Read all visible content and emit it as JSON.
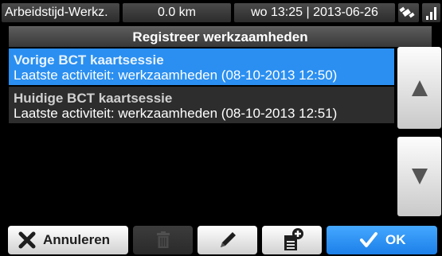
{
  "status": {
    "app_name": "Arbeidstijd-Werkz.",
    "distance": "0.0 km",
    "datetime": "wo 13:25 | 2013-06-26"
  },
  "dialog": {
    "title": "Registreer werkzaamheden"
  },
  "sessions": [
    {
      "name": "Vorige BCT kaartsessie",
      "activity": "Laatste activiteit: werkzaamheden (08-10-2013 12:50)",
      "selected": true
    },
    {
      "name": "Huidige BCT kaartsessie",
      "activity": "Laatste activiteit: werkzaamheden (08-10-2013 12:51)",
      "selected": false
    }
  ],
  "buttons": {
    "cancel": "Annuleren",
    "ok": "OK"
  },
  "icons": {
    "status_1": "satellite-icon",
    "status_2": "signal-strength-icon",
    "scroll_up": "triangle-up-icon",
    "scroll_down": "triangle-down-icon",
    "cancel": "x-icon",
    "delete": "trash-icon",
    "edit": "pencil-icon",
    "add": "document-add-icon",
    "ok": "checkmark-icon"
  },
  "colors": {
    "selection": "#2a8ff1",
    "ok_button": "#1b7fe9",
    "background": "#000000"
  }
}
